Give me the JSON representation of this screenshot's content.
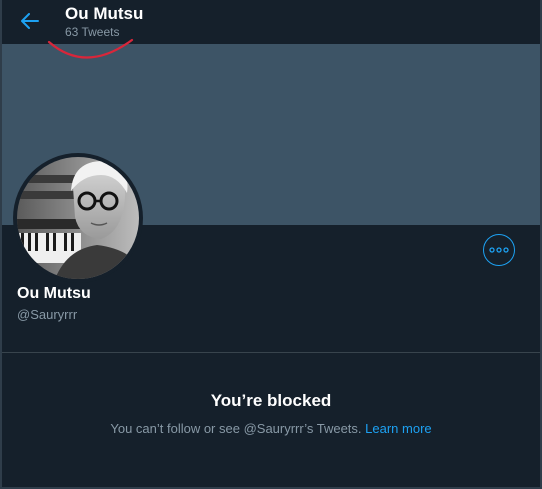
{
  "header": {
    "name": "Ou Mutsu",
    "tweet_count": "63 Tweets",
    "back_icon": "arrow-left-icon"
  },
  "profile": {
    "name": "Ou Mutsu",
    "handle": "@Sauryrrr",
    "more_icon": "more-horizontal-icon"
  },
  "blocked": {
    "title": "You’re blocked",
    "message": "You can’t follow or see @Sauryrrr’s Tweets.",
    "link": "Learn more"
  },
  "colors": {
    "background": "#15202b",
    "banner": "#3d5466",
    "accent": "#1da1f2",
    "muted_text": "#8899a6",
    "annotation": "#e0245e"
  }
}
